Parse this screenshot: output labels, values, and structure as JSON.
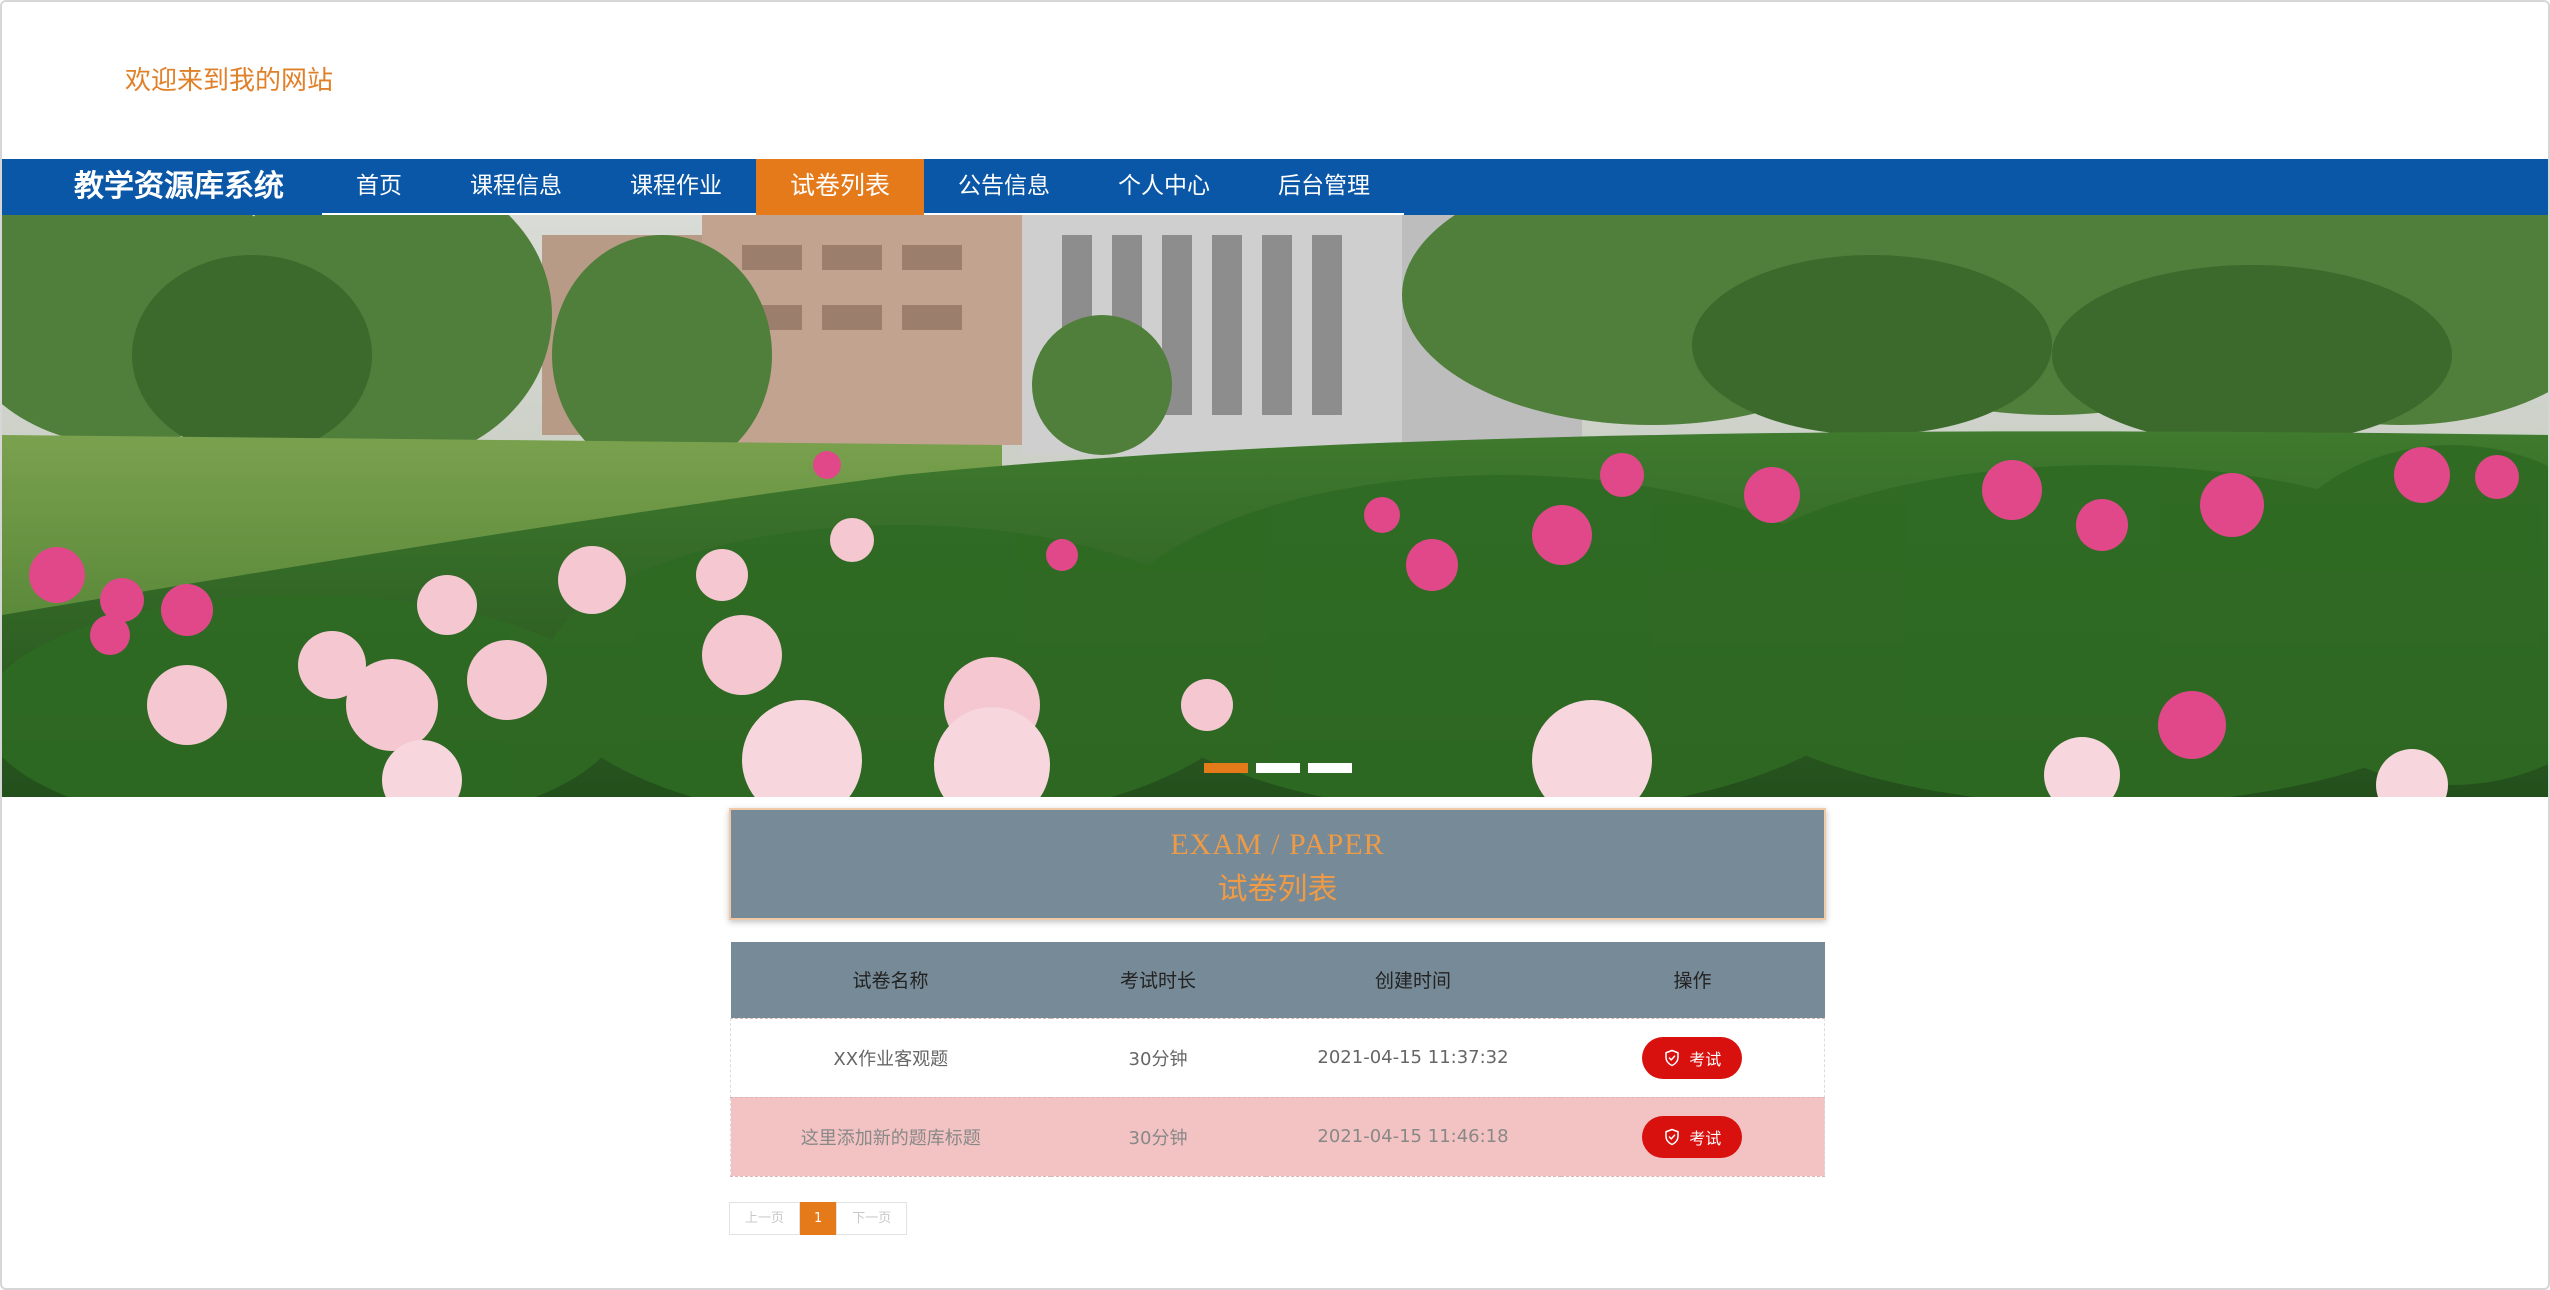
{
  "header": {
    "welcome": "欢迎来到我的网站"
  },
  "nav": {
    "brand": "教学资源库系统",
    "items": [
      {
        "label": "首页"
      },
      {
        "label": "课程信息"
      },
      {
        "label": "课程作业"
      },
      {
        "label": "试卷列表",
        "active": true
      },
      {
        "label": "公告信息"
      },
      {
        "label": "个人中心"
      },
      {
        "label": "后台管理"
      }
    ]
  },
  "banner": {
    "slides_total": 3,
    "active_slide": 1
  },
  "section": {
    "title_en": "EXAM / PAPER",
    "title_cn": "试卷列表"
  },
  "table": {
    "headers": [
      "试卷名称",
      "考试时长",
      "创建时间",
      "操作"
    ],
    "rows": [
      {
        "name": "XX作业客观题",
        "duration": "30分钟",
        "created": "2021-04-15 11:37:32",
        "action": "考试"
      },
      {
        "name": "这里添加新的题库标题",
        "duration": "30分钟",
        "created": "2021-04-15 11:46:18",
        "action": "考试"
      }
    ]
  },
  "pagination": {
    "prev": "上一页",
    "current": "1",
    "next": "下一页"
  },
  "colors": {
    "nav_bg": "#0b57a7",
    "accent": "#e57a1a",
    "header_gray": "#778a97",
    "exam_button": "#d8110f",
    "welcome_text": "#e0812a"
  }
}
